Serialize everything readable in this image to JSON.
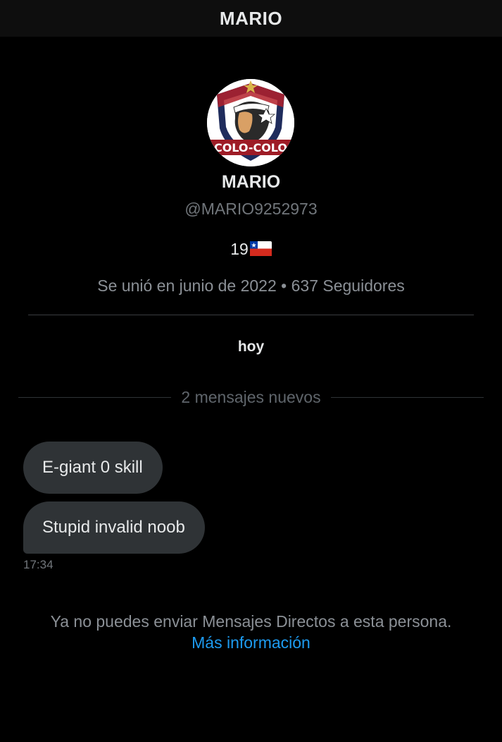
{
  "header": {
    "title": "MARIO"
  },
  "profile": {
    "avatar_text": "COLO-COLO",
    "name": "MARIO",
    "handle": "@MARIO9252973",
    "bio_number": "19",
    "bio_flag": "chile-flag-icon",
    "joined": "Se unió en junio de 2022",
    "separator": "•",
    "followers": "637 Seguidores"
  },
  "conversation": {
    "date_label": "hoy",
    "new_messages_label": "2 mensajes nuevos",
    "messages": [
      {
        "text": "E-giant 0 skill"
      },
      {
        "text": "Stupid invalid noob"
      }
    ],
    "timestamp": "17:34"
  },
  "footer": {
    "notice": "Ya no puedes enviar Mensajes Directos a esta persona.",
    "link": "Más información"
  },
  "colors": {
    "background": "#000000",
    "bubble": "#2f3336",
    "link": "#1d9bf0",
    "secondary_text": "#71767b"
  }
}
